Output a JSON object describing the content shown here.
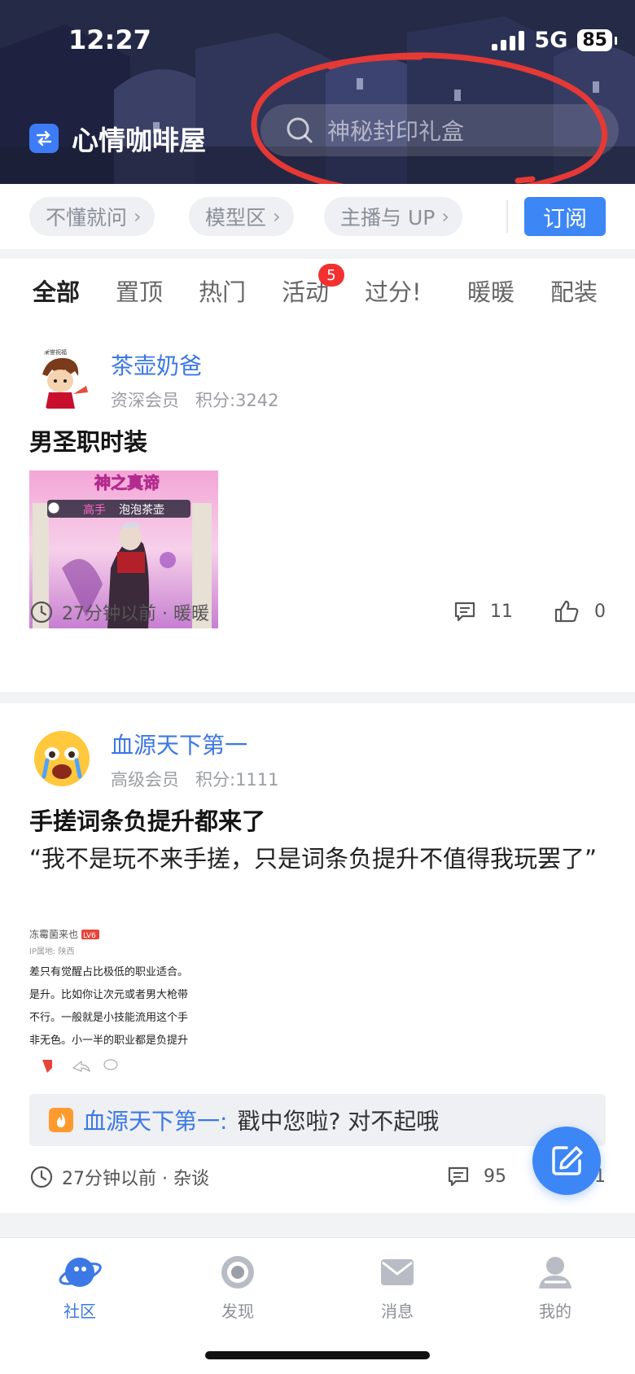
{
  "status_bar": {
    "time": "12:27",
    "network": "5G",
    "battery": "85"
  },
  "header": {
    "title": "心情咖啡屋",
    "search_placeholder": "神秘封印礼盒"
  },
  "chips": [
    "不懂就问",
    "模型区",
    "主播与 UP"
  ],
  "subscribe_label": "订阅",
  "tabs": {
    "items": [
      "全部",
      "置顶",
      "热门",
      "活动",
      "过分!",
      "暖暖",
      "配装"
    ],
    "active": "全部",
    "badge": "5"
  },
  "posts": [
    {
      "username": "茶壶奶爸",
      "level": "资深会员",
      "score": "积分:3242",
      "title": "男圣职时装",
      "image_caption_top": "神之真谛",
      "image_caption_tag": "高手",
      "image_caption_name": "泡泡茶壶",
      "avatar_caption": "荣誉祝福",
      "time": "27分钟以前 · 暖暖",
      "comments": "11",
      "likes": "0"
    },
    {
      "username": "血源天下第一",
      "level": "高级会员",
      "score": "积分:1111",
      "title": "手搓词条负提升都来了",
      "body": "“我不是玩不来手搓，只是词条负提升不值得我玩罢了”",
      "image_lines": [
        "冻霉菌来也",
        "IP属地: 陕西",
        "差只有觉醒占比极低的职业适合。",
        "是升。比如你让次元或者男大枪带",
        "不行。一般就是小技能流用这个手",
        "非无色。小一半的职业都是负提升"
      ],
      "image_badge": "LV6",
      "reply_user": "血源天下第一:",
      "reply_text": "戳中您啦? 对不起哦",
      "time": "27分钟以前 · 杂谈",
      "comments": "95",
      "likes": "1"
    }
  ],
  "bottom_nav": {
    "items": [
      "社区",
      "发现",
      "消息",
      "我的"
    ],
    "active": "社区"
  },
  "colors": {
    "accent": "#3d86f5",
    "link": "#3c78e6",
    "badge": "#f23030",
    "annotation": "#e53935"
  }
}
